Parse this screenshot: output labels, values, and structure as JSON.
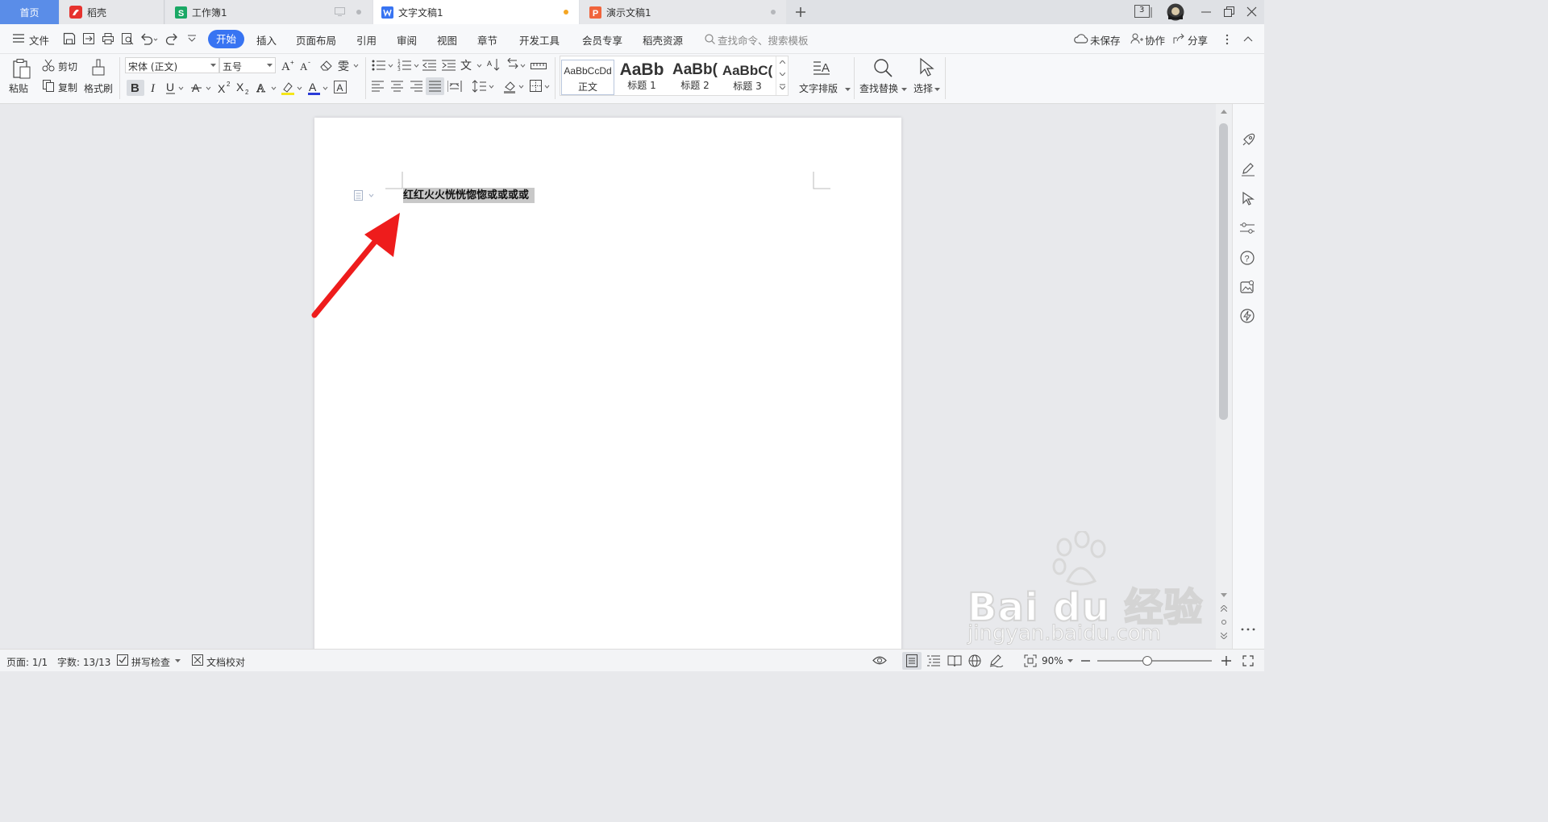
{
  "tabs": {
    "home": "首页",
    "items": [
      {
        "label": "稻壳"
      },
      {
        "label": "工作簿1"
      },
      {
        "label": "文字文稿1"
      },
      {
        "label": "演示文稿1"
      }
    ],
    "window_count": "3"
  },
  "menu": {
    "file": "文件",
    "items": [
      "开始",
      "插入",
      "页面布局",
      "引用",
      "审阅",
      "视图",
      "章节",
      "开发工具",
      "会员专享",
      "稻壳资源"
    ],
    "search_placeholder": "查找命令、搜索模板",
    "unsaved": "未保存",
    "collab": "协作",
    "share": "分享"
  },
  "ribbon": {
    "paste": "粘贴",
    "cut": "剪切",
    "copy": "复制",
    "format_painter": "格式刷",
    "font_name": "宋体 (正文)",
    "font_size": "五号",
    "styles": [
      {
        "preview": "AaBbCcDd",
        "label": "正文"
      },
      {
        "preview": "AaBb",
        "label": "标题 1"
      },
      {
        "preview": "AaBb(",
        "label": "标题 2"
      },
      {
        "preview": "AaBbC(",
        "label": "标题 3"
      }
    ],
    "text_layout": "文字排版",
    "find_replace": "查找替换",
    "select": "选择"
  },
  "document": {
    "text": "红红火火恍恍惚惚或或或或"
  },
  "status": {
    "page": "页面: 1/1",
    "words": "字数: 13/13",
    "spell": "拼写检查",
    "proof": "文档校对",
    "zoom": "90%"
  },
  "watermark": {
    "site": "jingyan.baidu.com",
    "brand": "Bai du 经验"
  },
  "colors": {
    "accent": "#3874f2",
    "arrow": "#ee1c1c",
    "selection": "#c8c8c8"
  }
}
